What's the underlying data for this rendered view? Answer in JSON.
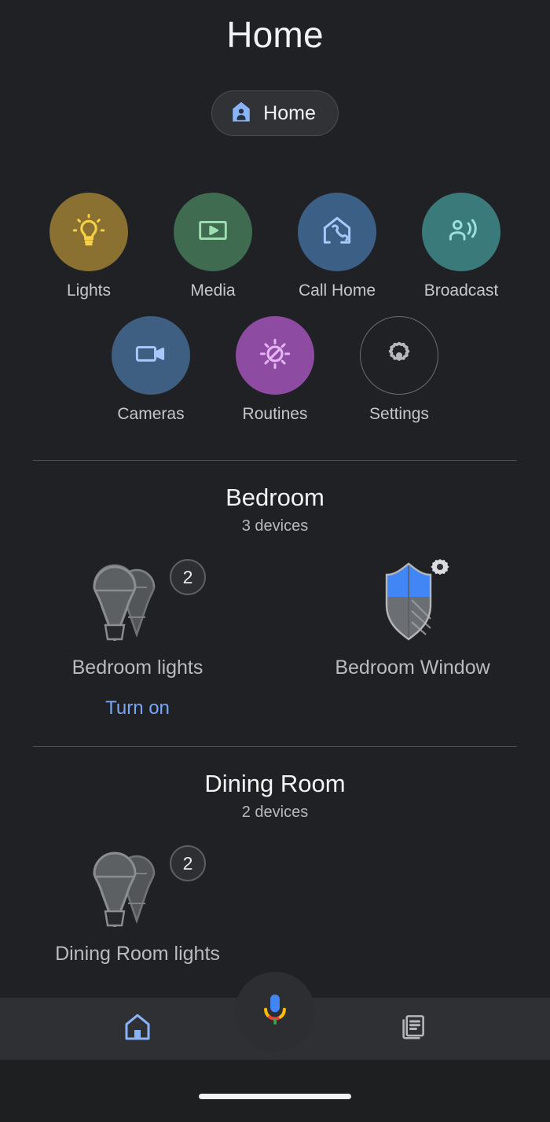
{
  "header": {
    "title": "Home",
    "home_chip": {
      "label": "Home",
      "icon": "home-person-icon",
      "color": "#8ab4f8"
    }
  },
  "quick_actions": {
    "row1": [
      {
        "label": "Lights",
        "icon": "lightbulb-icon",
        "circle_color": "#8a7031",
        "icon_color": "#f6d048"
      },
      {
        "label": "Media",
        "icon": "media-play-icon",
        "circle_color": "#3f6b50",
        "icon_color": "#9fe0b3"
      },
      {
        "label": "Call Home",
        "icon": "call-home-icon",
        "circle_color": "#3c5f86",
        "icon_color": "#a8c7fa"
      },
      {
        "label": "Broadcast",
        "icon": "broadcast-icon",
        "circle_color": "#3b7a7a",
        "icon_color": "#9ae0e0"
      }
    ],
    "row2": [
      {
        "label": "Cameras",
        "icon": "video-camera-icon",
        "circle_color": "#3f5f82",
        "icon_color": "#a8c7fa"
      },
      {
        "label": "Routines",
        "icon": "routines-sun-icon",
        "circle_color": "#8e4ba2",
        "icon_color": "#e4b6f5"
      },
      {
        "label": "Settings",
        "icon": "gear-icon",
        "circle_color": "transparent",
        "icon_color": "#b6b9bc"
      }
    ]
  },
  "rooms": [
    {
      "name": "Bedroom",
      "device_count": "3 devices",
      "devices": [
        {
          "name": "Bedroom lights",
          "icon": "two-lightbulbs-icon",
          "badge": "2",
          "action": "Turn on"
        },
        {
          "name": "Bedroom Window",
          "icon": "shield-gear-icon",
          "badge": "",
          "action": ""
        }
      ]
    },
    {
      "name": "Dining Room",
      "device_count": "2 devices",
      "devices": [
        {
          "name": "Dining Room lights",
          "icon": "two-lightbulbs-icon",
          "badge": "2",
          "action": ""
        }
      ]
    }
  ],
  "assistant": {
    "icon": "google-assistant-mic-icon"
  },
  "bottom_nav": {
    "items": [
      {
        "icon": "home-icon",
        "active": true,
        "color": "#8ab4f8"
      },
      {
        "icon": "feed-icon",
        "active": false,
        "color": "#b6b9bc"
      }
    ]
  },
  "colors": {
    "page_background": "#202124",
    "nav_background": "#2e3034",
    "accent_blue": "#8ab4f8",
    "text_primary": "#f1f3f4",
    "text_secondary": "#b6b9bc"
  }
}
